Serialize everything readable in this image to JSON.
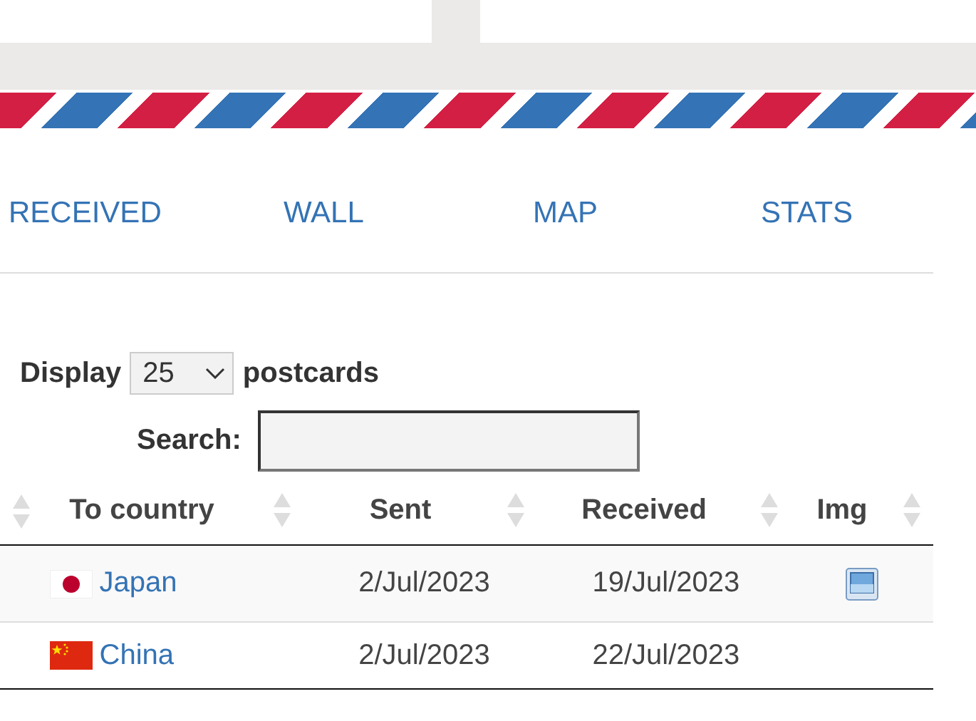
{
  "nav": [
    {
      "label": "RECEIVED"
    },
    {
      "label": "WALL"
    },
    {
      "label": "MAP"
    },
    {
      "label": "STATS"
    }
  ],
  "display": {
    "label_before": "Display",
    "value": "25",
    "label_after": "postcards"
  },
  "search": {
    "label": "Search:"
  },
  "table": {
    "columns": [
      "To country",
      "Sent",
      "Received",
      "Img"
    ],
    "rows": [
      {
        "country": "Japan",
        "kind": "jp",
        "sent": "2/Jul/2023",
        "received": "19/Jul/2023",
        "has_image": true
      },
      {
        "country": "China",
        "kind": "cn",
        "sent": "2/Jul/2023",
        "received": "22/Jul/2023",
        "has_image": false
      }
    ]
  }
}
